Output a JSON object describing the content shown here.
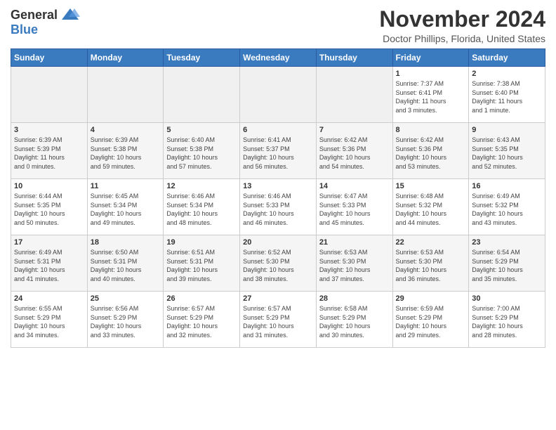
{
  "header": {
    "logo_general": "General",
    "logo_blue": "Blue",
    "month_title": "November 2024",
    "location": "Doctor Phillips, Florida, United States"
  },
  "calendar": {
    "days_of_week": [
      "Sunday",
      "Monday",
      "Tuesday",
      "Wednesday",
      "Thursday",
      "Friday",
      "Saturday"
    ],
    "weeks": [
      [
        {
          "day": "",
          "info": ""
        },
        {
          "day": "",
          "info": ""
        },
        {
          "day": "",
          "info": ""
        },
        {
          "day": "",
          "info": ""
        },
        {
          "day": "",
          "info": ""
        },
        {
          "day": "1",
          "info": "Sunrise: 7:37 AM\nSunset: 6:41 PM\nDaylight: 11 hours\nand 3 minutes."
        },
        {
          "day": "2",
          "info": "Sunrise: 7:38 AM\nSunset: 6:40 PM\nDaylight: 11 hours\nand 1 minute."
        }
      ],
      [
        {
          "day": "3",
          "info": "Sunrise: 6:39 AM\nSunset: 5:39 PM\nDaylight: 11 hours\nand 0 minutes."
        },
        {
          "day": "4",
          "info": "Sunrise: 6:39 AM\nSunset: 5:38 PM\nDaylight: 10 hours\nand 59 minutes."
        },
        {
          "day": "5",
          "info": "Sunrise: 6:40 AM\nSunset: 5:38 PM\nDaylight: 10 hours\nand 57 minutes."
        },
        {
          "day": "6",
          "info": "Sunrise: 6:41 AM\nSunset: 5:37 PM\nDaylight: 10 hours\nand 56 minutes."
        },
        {
          "day": "7",
          "info": "Sunrise: 6:42 AM\nSunset: 5:36 PM\nDaylight: 10 hours\nand 54 minutes."
        },
        {
          "day": "8",
          "info": "Sunrise: 6:42 AM\nSunset: 5:36 PM\nDaylight: 10 hours\nand 53 minutes."
        },
        {
          "day": "9",
          "info": "Sunrise: 6:43 AM\nSunset: 5:35 PM\nDaylight: 10 hours\nand 52 minutes."
        }
      ],
      [
        {
          "day": "10",
          "info": "Sunrise: 6:44 AM\nSunset: 5:35 PM\nDaylight: 10 hours\nand 50 minutes."
        },
        {
          "day": "11",
          "info": "Sunrise: 6:45 AM\nSunset: 5:34 PM\nDaylight: 10 hours\nand 49 minutes."
        },
        {
          "day": "12",
          "info": "Sunrise: 6:46 AM\nSunset: 5:34 PM\nDaylight: 10 hours\nand 48 minutes."
        },
        {
          "day": "13",
          "info": "Sunrise: 6:46 AM\nSunset: 5:33 PM\nDaylight: 10 hours\nand 46 minutes."
        },
        {
          "day": "14",
          "info": "Sunrise: 6:47 AM\nSunset: 5:33 PM\nDaylight: 10 hours\nand 45 minutes."
        },
        {
          "day": "15",
          "info": "Sunrise: 6:48 AM\nSunset: 5:32 PM\nDaylight: 10 hours\nand 44 minutes."
        },
        {
          "day": "16",
          "info": "Sunrise: 6:49 AM\nSunset: 5:32 PM\nDaylight: 10 hours\nand 43 minutes."
        }
      ],
      [
        {
          "day": "17",
          "info": "Sunrise: 6:49 AM\nSunset: 5:31 PM\nDaylight: 10 hours\nand 41 minutes."
        },
        {
          "day": "18",
          "info": "Sunrise: 6:50 AM\nSunset: 5:31 PM\nDaylight: 10 hours\nand 40 minutes."
        },
        {
          "day": "19",
          "info": "Sunrise: 6:51 AM\nSunset: 5:31 PM\nDaylight: 10 hours\nand 39 minutes."
        },
        {
          "day": "20",
          "info": "Sunrise: 6:52 AM\nSunset: 5:30 PM\nDaylight: 10 hours\nand 38 minutes."
        },
        {
          "day": "21",
          "info": "Sunrise: 6:53 AM\nSunset: 5:30 PM\nDaylight: 10 hours\nand 37 minutes."
        },
        {
          "day": "22",
          "info": "Sunrise: 6:53 AM\nSunset: 5:30 PM\nDaylight: 10 hours\nand 36 minutes."
        },
        {
          "day": "23",
          "info": "Sunrise: 6:54 AM\nSunset: 5:29 PM\nDaylight: 10 hours\nand 35 minutes."
        }
      ],
      [
        {
          "day": "24",
          "info": "Sunrise: 6:55 AM\nSunset: 5:29 PM\nDaylight: 10 hours\nand 34 minutes."
        },
        {
          "day": "25",
          "info": "Sunrise: 6:56 AM\nSunset: 5:29 PM\nDaylight: 10 hours\nand 33 minutes."
        },
        {
          "day": "26",
          "info": "Sunrise: 6:57 AM\nSunset: 5:29 PM\nDaylight: 10 hours\nand 32 minutes."
        },
        {
          "day": "27",
          "info": "Sunrise: 6:57 AM\nSunset: 5:29 PM\nDaylight: 10 hours\nand 31 minutes."
        },
        {
          "day": "28",
          "info": "Sunrise: 6:58 AM\nSunset: 5:29 PM\nDaylight: 10 hours\nand 30 minutes."
        },
        {
          "day": "29",
          "info": "Sunrise: 6:59 AM\nSunset: 5:29 PM\nDaylight: 10 hours\nand 29 minutes."
        },
        {
          "day": "30",
          "info": "Sunrise: 7:00 AM\nSunset: 5:29 PM\nDaylight: 10 hours\nand 28 minutes."
        }
      ]
    ]
  }
}
